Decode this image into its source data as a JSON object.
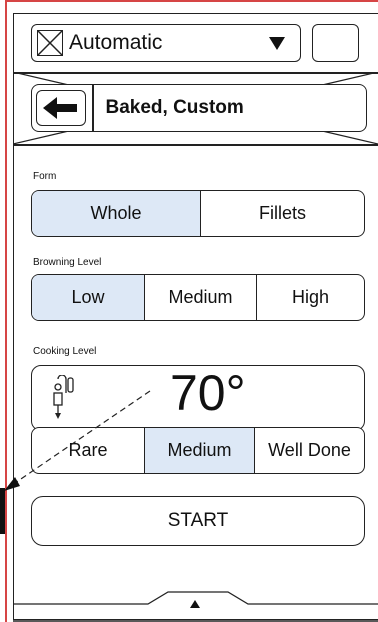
{
  "header": {
    "mode_label": "Automatic",
    "mode_icon": "crossed-box-icon",
    "title": "Baked, Custom"
  },
  "form": {
    "label": "Form",
    "options": [
      "Whole",
      "Fillets"
    ],
    "selected": "Whole"
  },
  "browning": {
    "label": "Browning Level",
    "options": [
      "Low",
      "Medium",
      "High"
    ],
    "selected": "Low"
  },
  "cooking": {
    "label": "Cooking Level",
    "temperature": "70°",
    "probe_icon": "thermometer-probe-icon",
    "options": [
      "Rare",
      "Medium",
      "Well Done"
    ],
    "selected": "Medium"
  },
  "actions": {
    "start_label": "START"
  },
  "colors": {
    "selected_bg": "#dde8f6",
    "border": "#222222",
    "edge_line": "#d64545"
  }
}
